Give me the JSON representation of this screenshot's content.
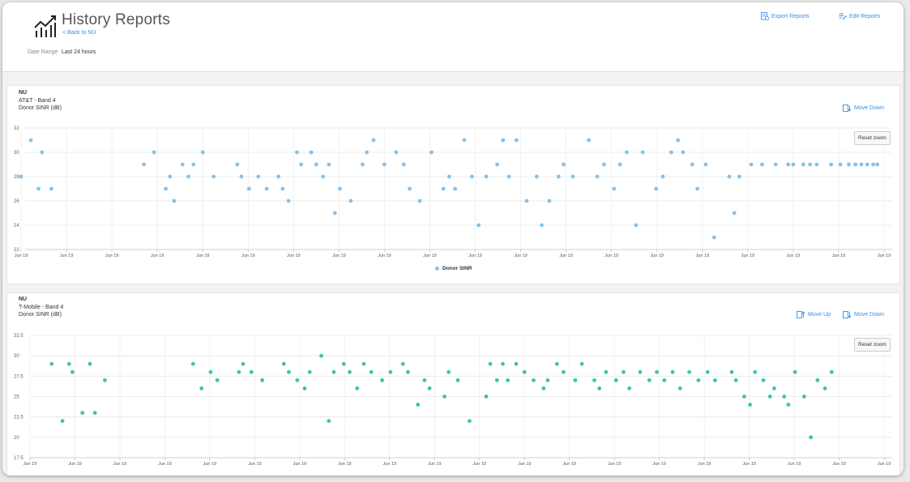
{
  "header": {
    "title": "History Reports",
    "back_link": "< Back to NU",
    "date_range_label": "Date Range",
    "date_range_value": "Last 24 hours",
    "export_label": "Export Reports",
    "edit_label": "Edit Reports"
  },
  "colors": {
    "accent": "#3a8ee6",
    "series1": "#88c1e6",
    "series2": "#3fc3ad"
  },
  "panel1": {
    "line1": "NU",
    "line2": "AT&T - Band 4",
    "line3": "Donor SINR  (dB)",
    "move_down": "Move Down",
    "reset_zoom": "Reset zoom",
    "legend": "Donor SINR"
  },
  "panel2": {
    "line1": "NU",
    "line2": "T-Mobile - Band 4",
    "line3": "Donor SINR  (dB)",
    "move_up": "Move Up",
    "move_down": "Move Down",
    "reset_zoom": "Reset zoom"
  },
  "chart_data": [
    {
      "type": "scatter",
      "title": "",
      "xlabel": "",
      "ylabel": "",
      "grid": true,
      "legend_position": "bottom",
      "ylim": [
        22,
        32
      ],
      "y_ticks": [
        "22",
        "24",
        "26",
        "28",
        "30",
        "32"
      ],
      "x_tick_labels": [
        "Jun 19",
        "Jun 19",
        "Jun 19",
        "Jun 19",
        "Jun 19",
        "Jun 19",
        "Jun 19",
        "Jun 19",
        "Jun 19",
        "Jun 19",
        "Jun 19",
        "Jun 19",
        "Jun 19",
        "Jun 19",
        "Jun 19",
        "Jun 19",
        "Jun 19",
        "Jun 19",
        "Jun 19",
        "Jun 19"
      ],
      "series": [
        {
          "name": "Donor SINR",
          "x": [
            0,
            1.16,
            2.07,
            2.48,
            3.6,
            14.6,
            15.8,
            17.2,
            17.7,
            18.2,
            19.2,
            19.9,
            20.5,
            21.6,
            22.9,
            25.7,
            26.2,
            27.1,
            28.2,
            29.2,
            30.6,
            31.1,
            31.8,
            32.8,
            33.3,
            34.5,
            35.1,
            35.9,
            36.6,
            37.3,
            37.9,
            39.2,
            40.6,
            41.1,
            41.9,
            43.2,
            44.6,
            45.5,
            46.2,
            47.4,
            48.8,
            50.2,
            50.9,
            51.6,
            52.7,
            53.6,
            54.4,
            55.3,
            56.6,
            57.3,
            58.0,
            58.9,
            60.1,
            61.3,
            61.9,
            62.8,
            63.9,
            64.5,
            65.6,
            67.5,
            68.5,
            69.3,
            70.5,
            71.2,
            72.0,
            73.1,
            73.9,
            75.5,
            76.3,
            77.3,
            78.1,
            78.7,
            79.8,
            80.4,
            81.4,
            82.4,
            84.2,
            84.8,
            85.4,
            86.8,
            88.1,
            89.7,
            91.2,
            91.8,
            93.0,
            93.8,
            94.6,
            96.3,
            97.4,
            98.4,
            99.2,
            99.9,
            100.6,
            101.3,
            101.8
          ],
          "y": [
            28,
            31,
            27,
            30,
            27,
            29,
            30,
            27,
            28,
            26,
            29,
            28,
            29,
            30,
            28,
            29,
            28,
            27,
            28,
            27,
            28,
            27,
            26,
            30,
            29,
            30,
            29,
            28,
            29,
            25,
            27,
            26,
            29,
            30,
            31,
            29,
            30,
            29,
            27,
            26,
            30,
            27,
            28,
            27,
            31,
            28,
            24,
            28,
            29,
            31,
            28,
            31,
            26,
            28,
            24,
            26,
            28,
            29,
            28,
            31,
            28,
            29,
            27,
            29,
            30,
            24,
            30,
            27,
            28,
            30,
            31,
            30,
            29,
            27,
            29,
            23,
            28,
            25,
            28,
            29,
            29,
            29,
            29,
            29,
            29,
            29,
            29,
            29,
            29,
            29,
            29,
            29,
            29,
            29,
            29
          ]
        }
      ]
    },
    {
      "type": "scatter",
      "title": "",
      "xlabel": "",
      "ylabel": "",
      "grid": true,
      "ylim": [
        17.5,
        32.5
      ],
      "y_ticks": [
        "17.5",
        "20",
        "22.5",
        "25",
        "27.5",
        "30",
        "32.5"
      ],
      "x_tick_labels": [
        "Jun 19",
        "Jun 19",
        "Jun 19",
        "Jun 19",
        "Jun 19",
        "Jun 19",
        "Jun 19",
        "Jun 19",
        "Jun 19",
        "Jun 19",
        "Jun 19",
        "Jun 19",
        "Jun 19",
        "Jun 19",
        "Jun 19",
        "Jun 19",
        "Jun 19",
        "Jun 19",
        "Jun 19",
        "Jun 19"
      ],
      "series": [
        {
          "name": "",
          "x": [
            2.6,
            3.9,
            4.7,
            5.1,
            6.3,
            7.2,
            7.8,
            9.0,
            19.6,
            20.6,
            21.7,
            22.5,
            25.1,
            25.6,
            26.6,
            27.9,
            30.5,
            31.1,
            32.1,
            33.0,
            33.6,
            35.0,
            35.9,
            36.5,
            37.7,
            38.4,
            39.3,
            40.1,
            41.0,
            42.3,
            43.3,
            44.8,
            45.4,
            46.6,
            47.4,
            48.0,
            49.8,
            50.3,
            51.4,
            52.8,
            54.8,
            55.3,
            56.1,
            56.8,
            57.4,
            58.4,
            59.4,
            60.5,
            61.7,
            62.2,
            63.3,
            64.1,
            65.5,
            66.3,
            67.8,
            68.4,
            69.2,
            70.4,
            71.3,
            72.0,
            73.3,
            74.4,
            75.3,
            76.2,
            77.2,
            78.1,
            79.2,
            80.3,
            81.4,
            82.3,
            84.3,
            84.8,
            85.8,
            86.5,
            87.1,
            88.1,
            88.9,
            89.4,
            90.6,
            91.1,
            91.9,
            93.0,
            93.8,
            94.6,
            95.5,
            96.3
          ],
          "y": [
            29,
            22,
            29,
            28,
            23,
            29,
            23,
            27,
            29,
            26,
            28,
            27,
            28,
            29,
            28,
            27,
            29,
            28,
            27,
            26,
            28,
            30,
            22,
            28,
            29,
            28,
            26,
            29,
            28,
            27,
            28,
            29,
            28,
            24,
            27,
            26,
            25,
            28,
            27,
            22,
            25,
            29,
            27,
            29,
            27,
            29,
            28,
            27,
            26,
            27,
            29,
            28,
            27,
            29,
            27,
            26,
            28,
            27,
            28,
            26,
            28,
            27,
            28,
            27,
            28,
            26,
            28,
            27,
            28,
            27,
            28,
            27,
            25,
            24,
            28,
            27,
            25,
            26,
            25,
            24,
            28,
            25,
            20,
            27,
            26,
            28
          ]
        }
      ]
    }
  ]
}
